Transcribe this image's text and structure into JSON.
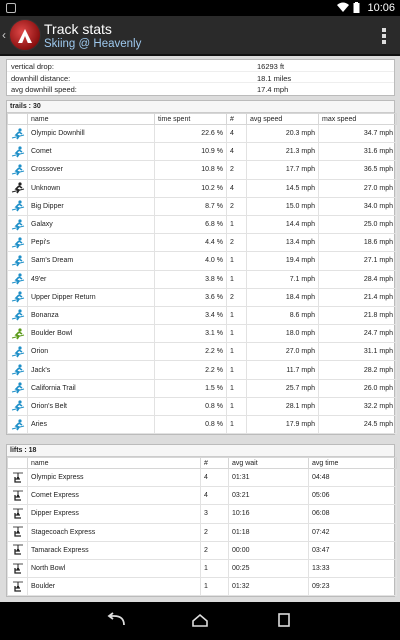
{
  "statusbar": {
    "time": "10:06"
  },
  "actionbar": {
    "title": "Track stats",
    "subtitle": "Skiing @ Heavenly"
  },
  "summary": [
    {
      "label": "vertical drop:",
      "value": "16293 ft"
    },
    {
      "label": "downhill distance:",
      "value": "18.1 miles"
    },
    {
      "label": "avg downhill speed:",
      "value": "17.4 mph"
    }
  ],
  "trails": {
    "title": "trails : 30",
    "columns": [
      "name",
      "time spent",
      "#",
      "avg speed",
      "max speed"
    ],
    "rows": [
      {
        "icon": "blue",
        "name": "Olympic Downhill",
        "time": "22.6 %",
        "count": "4",
        "avg": "20.3 mph",
        "max": "34.7 mph"
      },
      {
        "icon": "blue",
        "name": "Comet",
        "time": "10.9 %",
        "count": "4",
        "avg": "21.3 mph",
        "max": "31.6 mph"
      },
      {
        "icon": "blue",
        "name": "Crossover",
        "time": "10.8 %",
        "count": "2",
        "avg": "17.7 mph",
        "max": "36.5 mph"
      },
      {
        "icon": "black",
        "name": "Unknown",
        "time": "10.2 %",
        "count": "4",
        "avg": "14.5 mph",
        "max": "27.0 mph"
      },
      {
        "icon": "blue",
        "name": "Big Dipper",
        "time": "8.7 %",
        "count": "2",
        "avg": "15.0 mph",
        "max": "34.0 mph"
      },
      {
        "icon": "blue",
        "name": "Galaxy",
        "time": "6.8 %",
        "count": "1",
        "avg": "14.4 mph",
        "max": "25.0 mph"
      },
      {
        "icon": "blue",
        "name": "Pepi's",
        "time": "4.4 %",
        "count": "2",
        "avg": "13.4 mph",
        "max": "18.6 mph"
      },
      {
        "icon": "blue",
        "name": "Sam's Dream",
        "time": "4.0 %",
        "count": "1",
        "avg": "19.4 mph",
        "max": "27.1 mph"
      },
      {
        "icon": "blue",
        "name": "49'er",
        "time": "3.8 %",
        "count": "1",
        "avg": "7.1 mph",
        "max": "28.4 mph"
      },
      {
        "icon": "blue",
        "name": "Upper Dipper Return",
        "time": "3.6 %",
        "count": "2",
        "avg": "18.4 mph",
        "max": "21.4 mph"
      },
      {
        "icon": "blue",
        "name": "Bonanza",
        "time": "3.4 %",
        "count": "1",
        "avg": "8.6 mph",
        "max": "21.8 mph"
      },
      {
        "icon": "green",
        "name": "Boulder Bowl",
        "time": "3.1 %",
        "count": "1",
        "avg": "18.0 mph",
        "max": "24.7 mph"
      },
      {
        "icon": "blue",
        "name": "Orion",
        "time": "2.2 %",
        "count": "1",
        "avg": "27.0 mph",
        "max": "31.1 mph"
      },
      {
        "icon": "blue",
        "name": "Jack's",
        "time": "2.2 %",
        "count": "1",
        "avg": "11.7 mph",
        "max": "28.2 mph"
      },
      {
        "icon": "blue",
        "name": "California Trail",
        "time": "1.5 %",
        "count": "1",
        "avg": "25.7 mph",
        "max": "26.0 mph"
      },
      {
        "icon": "blue",
        "name": "Orion's Belt",
        "time": "0.8 %",
        "count": "1",
        "avg": "28.1 mph",
        "max": "32.2 mph"
      },
      {
        "icon": "blue",
        "name": "Aries",
        "time": "0.8 %",
        "count": "1",
        "avg": "17.9 mph",
        "max": "24.5 mph"
      }
    ]
  },
  "lifts": {
    "title": "lifts : 18",
    "columns": [
      "name",
      "#",
      "avg wait",
      "avg time"
    ],
    "rows": [
      {
        "name": "Olympic Express",
        "count": "4",
        "wait": "01:31",
        "time": "04:48"
      },
      {
        "name": "Comet Express",
        "count": "4",
        "wait": "03:21",
        "time": "05:06"
      },
      {
        "name": "Dipper Express",
        "count": "3",
        "wait": "10:16",
        "time": "06:08"
      },
      {
        "name": "Stagecoach Express",
        "count": "2",
        "wait": "01:18",
        "time": "07:42"
      },
      {
        "name": "Tamarack Express",
        "count": "2",
        "wait": "00:00",
        "time": "03:47"
      },
      {
        "name": "North Bowl",
        "count": "1",
        "wait": "00:25",
        "time": "13:33"
      },
      {
        "name": "Boulder",
        "count": "1",
        "wait": "01:32",
        "time": "09:23"
      }
    ]
  },
  "colors": {
    "blue": "#1e8fc8",
    "green": "#5a9a1a",
    "black": "#222222"
  }
}
